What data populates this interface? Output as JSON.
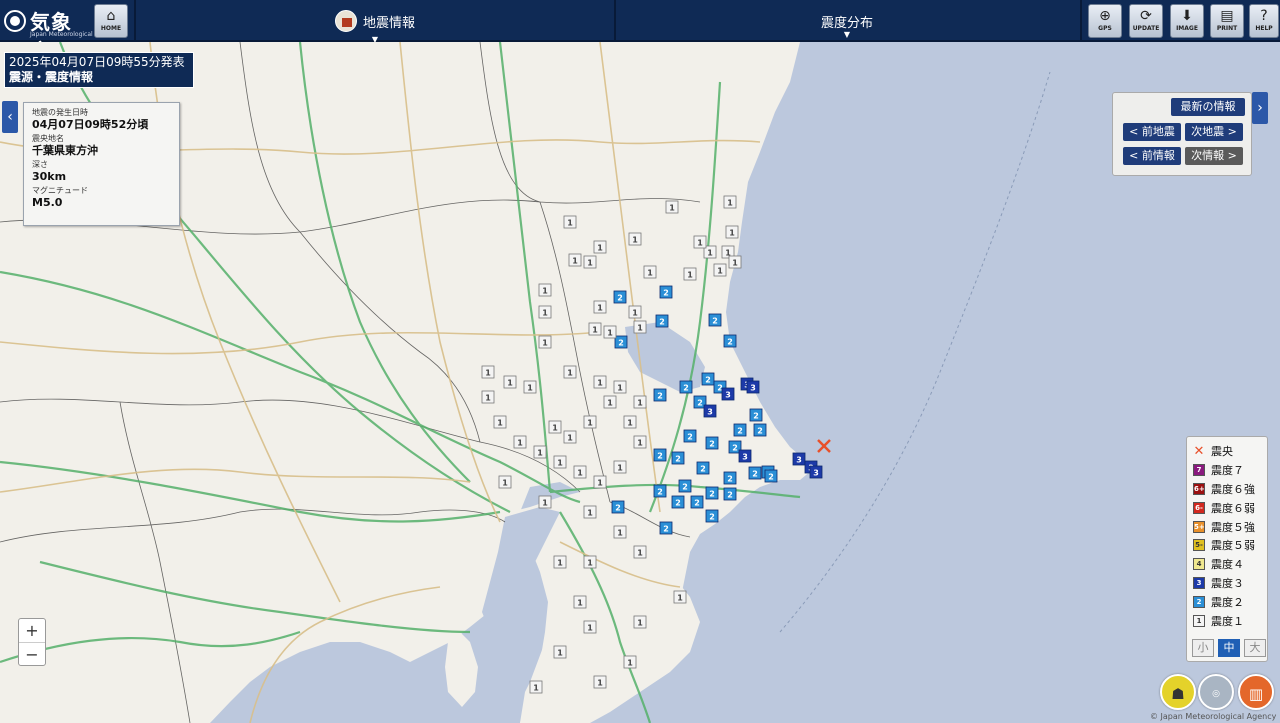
{
  "header": {
    "logo_name": "気象庁",
    "logo_sub": "Japan Meteorological Agency",
    "home_label": "HOME",
    "menu_earthquake": "地震情報",
    "menu_intensity": "震度分布",
    "gps_label": "GPS",
    "update_label": "UPDATE",
    "image_label": "IMAGE",
    "print_label": "PRINT",
    "help_label": "HELP"
  },
  "issue": {
    "time": "2025年04月07日09時55分発表",
    "type": "震源・震度情報"
  },
  "info": {
    "time_label": "地震の発生日時",
    "time_value": "04月07日09時52分頃",
    "area_label": "震央地名",
    "area_value": "千葉県東方沖",
    "depth_label": "深さ",
    "depth_value": "30km",
    "mag_label": "マグニチュード",
    "mag_value": "M5.0"
  },
  "nav": {
    "latest": "最新の情報",
    "prev_eq": "< 前地震",
    "next_eq": "次地震 >",
    "prev_info": "< 前情報",
    "next_info": "次情報 >"
  },
  "legend": {
    "epicenter": "震央",
    "items": [
      {
        "code": "7",
        "label": "震度７",
        "color": "#8a1a7e"
      },
      {
        "code": "6+",
        "label": "震度６強",
        "color": "#9b1010"
      },
      {
        "code": "6-",
        "label": "震度６弱",
        "color": "#d2281e"
      },
      {
        "code": "5+",
        "label": "震度５強",
        "color": "#e8902a"
      },
      {
        "code": "5-",
        "label": "震度５弱",
        "color": "#e0c020"
      },
      {
        "code": "4",
        "label": "震度４",
        "color": "#f0e890"
      },
      {
        "code": "3",
        "label": "震度３",
        "color": "#1d3aa8"
      },
      {
        "code": "2",
        "label": "震度２",
        "color": "#2b8fd6"
      },
      {
        "code": "1",
        "label": "震度１",
        "color": "#f4f4f4"
      }
    ],
    "sizes": [
      "小",
      "中",
      "大"
    ],
    "active_size": "中"
  },
  "zoom": {
    "in": "+",
    "out": "−"
  },
  "copyright": "© Japan Meteorological Agency",
  "colors": {
    "sea": "#bcc8dd",
    "land": "#f2f0ea",
    "header": "#0f2a55",
    "intensity3": "#1d3aa8",
    "intensity2": "#2b8fd6",
    "intensity1": "#f4f4f4",
    "epicenter": "#e8502a"
  }
}
